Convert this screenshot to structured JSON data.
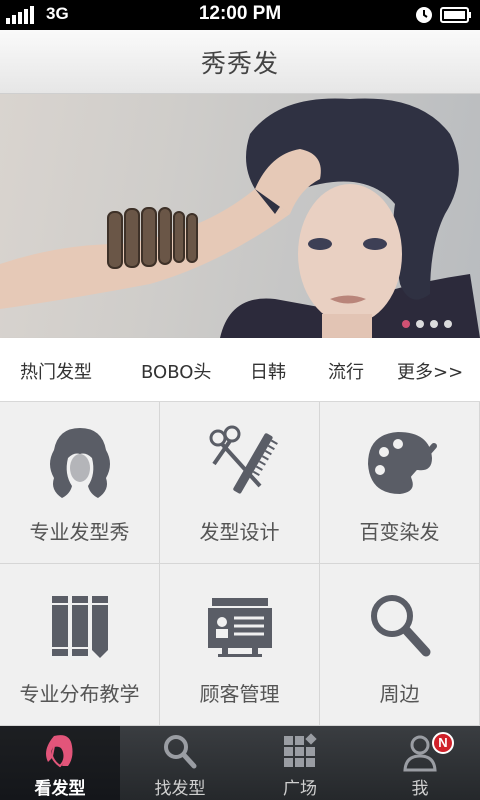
{
  "status_bar": {
    "network": "3G",
    "time": "12:00 PM",
    "icons": [
      "signal-icon",
      "clock-icon",
      "battery-icon"
    ]
  },
  "header": {
    "title": "秀秀发"
  },
  "banner": {
    "dots_count": 4,
    "active_dot": 1
  },
  "categories": [
    {
      "label": "热门发型"
    },
    {
      "label": "BOBO头"
    },
    {
      "label": "日韩"
    },
    {
      "label": "流行"
    },
    {
      "label": "更多>>"
    }
  ],
  "grid": [
    {
      "label": "专业发型秀",
      "icon": "hairstyle-icon"
    },
    {
      "label": "发型设计",
      "icon": "scissors-comb-icon"
    },
    {
      "label": "百变染发",
      "icon": "palette-icon"
    },
    {
      "label": "专业分布教学",
      "icon": "books-icon"
    },
    {
      "label": "顾客管理",
      "icon": "customer-card-icon"
    },
    {
      "label": "周边",
      "icon": "search-icon"
    }
  ],
  "tabs": [
    {
      "label": "看发型",
      "icon": "face-icon",
      "active": true
    },
    {
      "label": "找发型",
      "icon": "search-icon",
      "active": false
    },
    {
      "label": "广场",
      "icon": "grid-icon",
      "active": false
    },
    {
      "label": "我",
      "icon": "user-icon",
      "active": false,
      "badge": "N"
    }
  ],
  "colors": {
    "accent": "#e2557a",
    "icon_gray": "#5a5d66",
    "tabbar": "#2e3135",
    "badge": "#d0212a"
  }
}
